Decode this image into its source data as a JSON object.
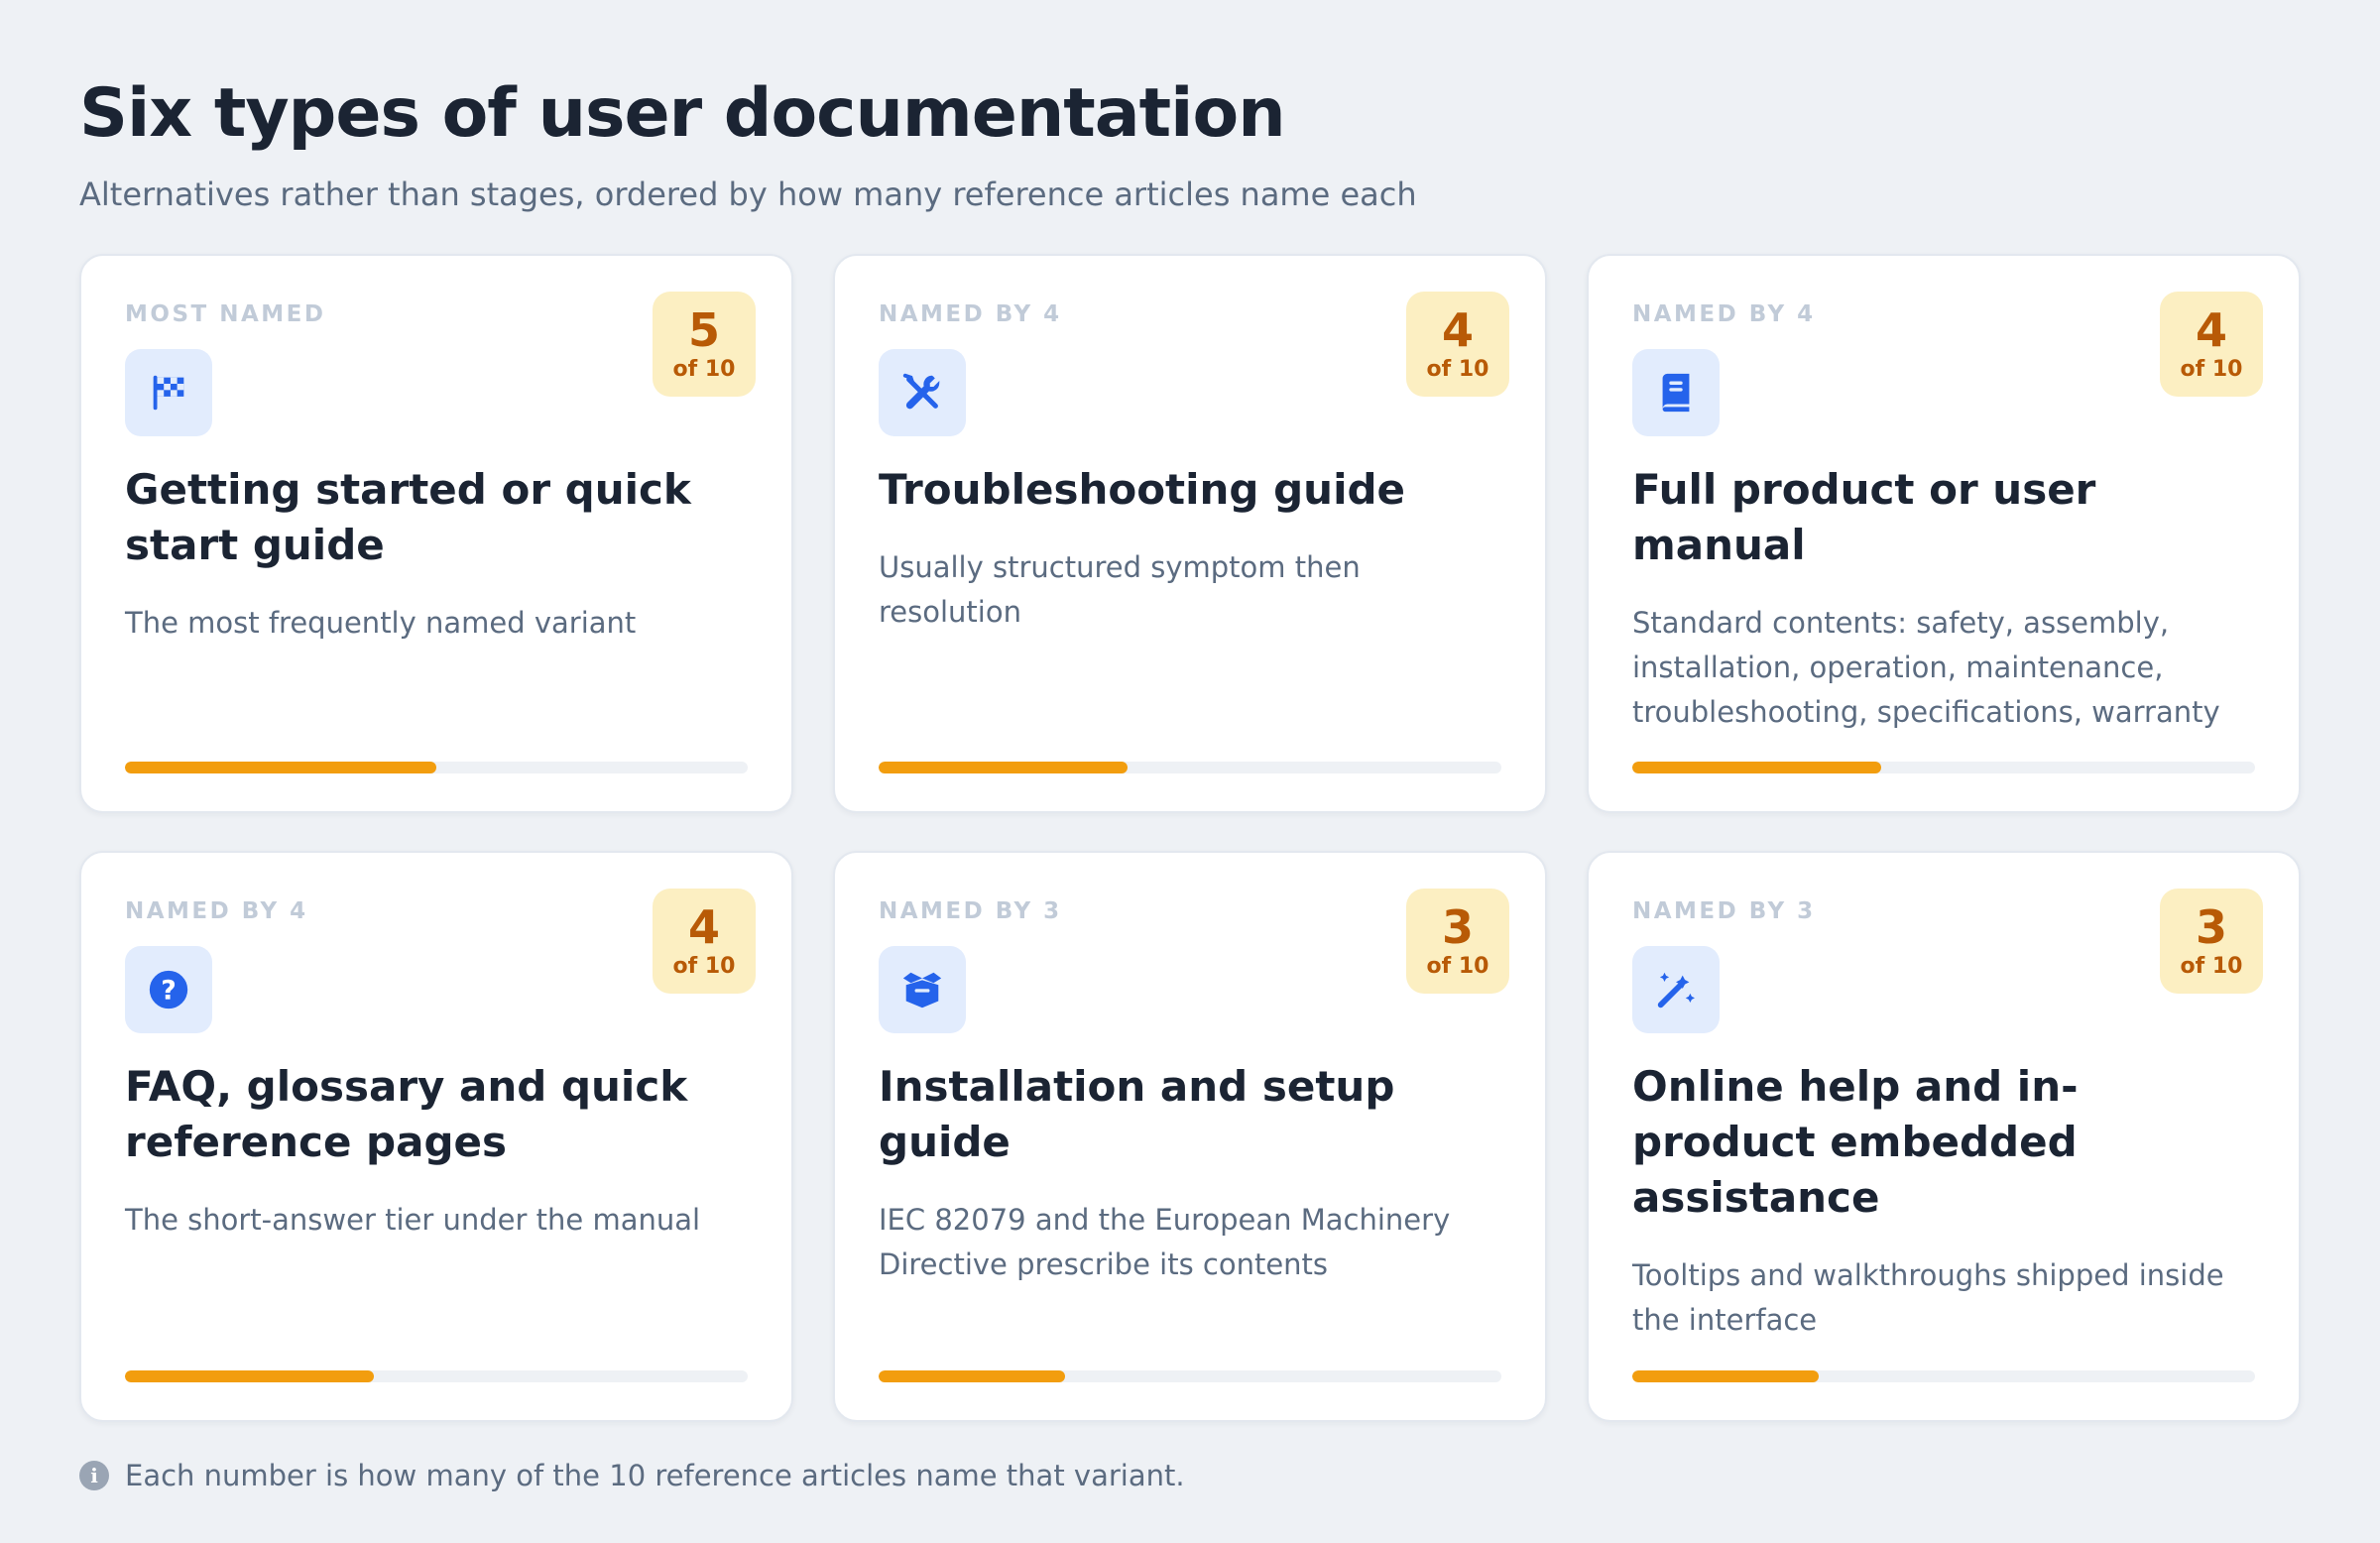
{
  "header": {
    "title": "Six types of user documentation",
    "subtitle": "Alternatives rather than stages, ordered by how many reference articles name each"
  },
  "accent_color": "#f29d0e",
  "cards": [
    {
      "tag": "MOST NAMED",
      "icon": "checkered-flag-icon",
      "count": "5",
      "of_label": "of 10",
      "title": "Getting started or quick start guide",
      "description": "The most frequently named variant",
      "fraction": 0.5
    },
    {
      "tag": "NAMED BY 4",
      "icon": "tools-icon",
      "count": "4",
      "of_label": "of 10",
      "title": "Troubleshooting guide",
      "description": "Usually structured symptom then resolution",
      "fraction": 0.4
    },
    {
      "tag": "NAMED BY 4",
      "icon": "book-icon",
      "count": "4",
      "of_label": "of 10",
      "title": "Full product or user manual",
      "description": "Standard contents: safety, assembly, installation, operation, maintenance, troubleshooting, specifications, warranty",
      "fraction": 0.4
    },
    {
      "tag": "NAMED BY 4",
      "icon": "question-circle-icon",
      "count": "4",
      "of_label": "of 10",
      "title": "FAQ, glossary and quick reference pages",
      "description": "The short-answer tier under the manual",
      "fraction": 0.4
    },
    {
      "tag": "NAMED BY 3",
      "icon": "open-box-icon",
      "count": "3",
      "of_label": "of 10",
      "title": "Installation and setup guide",
      "description": "IEC 82079 and the European Machinery Directive prescribe its contents",
      "fraction": 0.3
    },
    {
      "tag": "NAMED BY 3",
      "icon": "magic-wand-icon",
      "count": "3",
      "of_label": "of 10",
      "title": "Online help and in-product embedded assistance",
      "description": "Tooltips and walkthroughs shipped inside the interface",
      "fraction": 0.3
    }
  ],
  "footnote": {
    "icon": "info-icon",
    "text": "Each number is how many of the 10 reference articles name that variant."
  }
}
